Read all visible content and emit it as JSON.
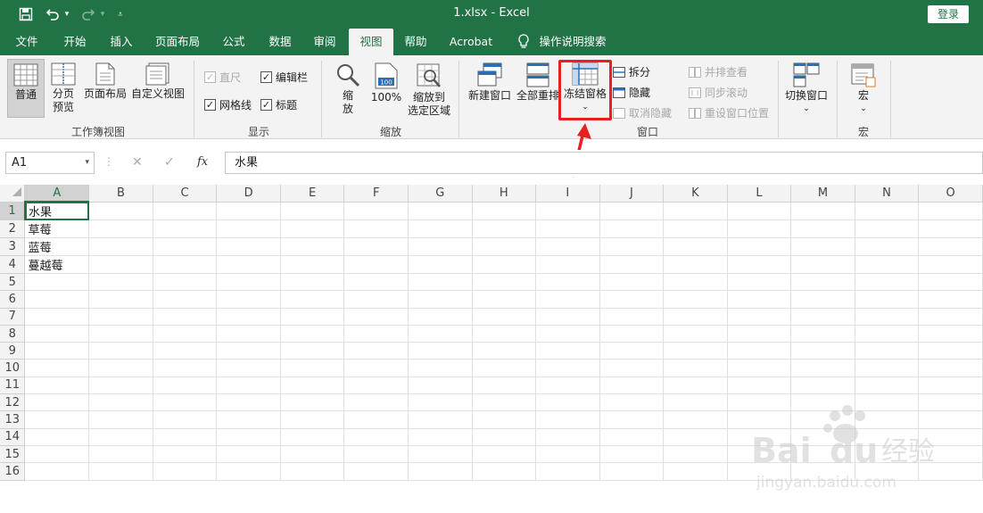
{
  "title_bar": {
    "title": "1.xlsx  -  Excel",
    "login_label": "登录",
    "bg_color": "#217346"
  },
  "tabs": [
    {
      "label": "文件"
    },
    {
      "label": "开始"
    },
    {
      "label": "插入"
    },
    {
      "label": "页面布局"
    },
    {
      "label": "公式"
    },
    {
      "label": "数据"
    },
    {
      "label": "审阅"
    },
    {
      "label": "视图"
    },
    {
      "label": "帮助"
    },
    {
      "label": "Acrobat"
    },
    {
      "label": "操作说明搜索"
    }
  ],
  "active_tab": "视图",
  "ribbon": {
    "workbook_views": {
      "group_label": "工作簿视图",
      "normal": "普通",
      "page_break_1": "分页",
      "page_break_2": "预览",
      "page_layout": "页面布局",
      "custom_views": "自定义视图"
    },
    "show": {
      "group_label": "显示",
      "ruler": "直尺",
      "formula_bar": "编辑栏",
      "gridlines": "网格线",
      "headings": "标题"
    },
    "zoom": {
      "group_label": "缩放",
      "zoom_1": "缩",
      "zoom_2": "放",
      "hundred": "100%",
      "zoom_sel_1": "缩放到",
      "zoom_sel_2": "选定区域"
    },
    "window": {
      "group_label": "窗口",
      "new_window": "新建窗口",
      "arrange_all": "全部重排",
      "freeze_panes": "冻结窗格",
      "split": "拆分",
      "hide": "隐藏",
      "unhide": "取消隐藏",
      "side_by_side": "并排查看",
      "sync_scroll": "同步滚动",
      "reset_position": "重设窗口位置",
      "switch_windows": "切换窗口"
    },
    "macros": {
      "group_label": "宏",
      "macros": "宏"
    }
  },
  "formula_bar": {
    "name_box": "A1",
    "cancel": "✕",
    "enter": "✓",
    "fx": "fx",
    "content": "水果"
  },
  "sheet": {
    "columns": [
      "A",
      "B",
      "C",
      "D",
      "E",
      "F",
      "G",
      "H",
      "I",
      "J",
      "K",
      "L",
      "M",
      "N",
      "O"
    ],
    "rows": [
      "1",
      "2",
      "3",
      "4",
      "5",
      "6",
      "7",
      "8",
      "9",
      "10",
      "11",
      "12",
      "13",
      "14",
      "15",
      "16"
    ],
    "cells": {
      "A1": "水果",
      "A2": "草莓",
      "A3": "蓝莓",
      "A4": "蔓越莓"
    },
    "selected_cell": "A1"
  },
  "watermark": {
    "brand": "Bai",
    "brand2": "du",
    "cn": "经验",
    "url": "jingyan.baidu.com"
  },
  "colors": {
    "accent": "#217346",
    "highlight": "#e82020"
  }
}
